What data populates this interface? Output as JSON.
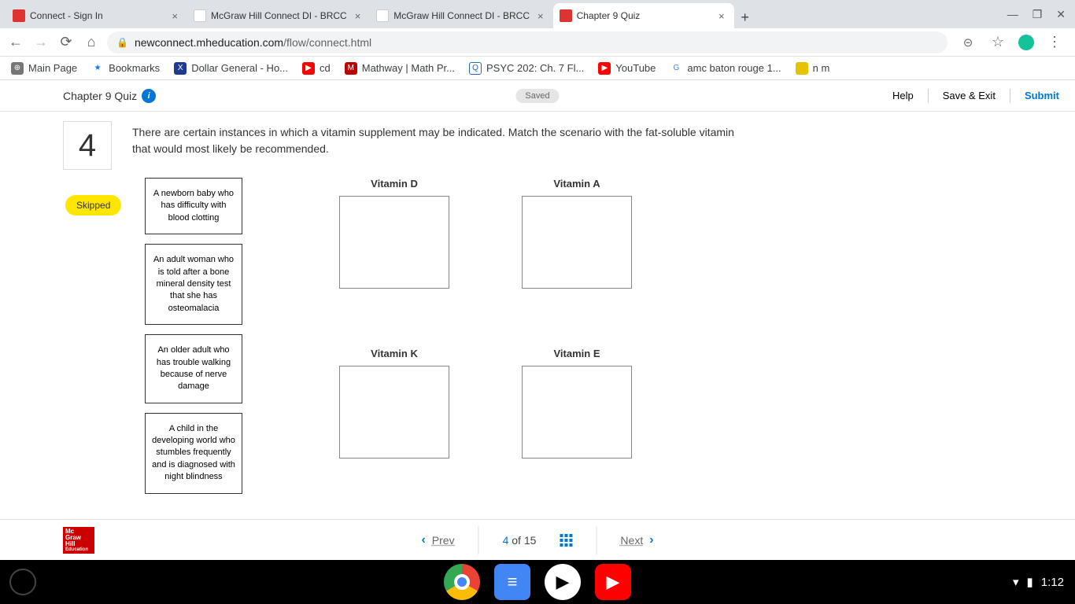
{
  "browser": {
    "tabs": [
      {
        "title": "Connect - Sign In"
      },
      {
        "title": "McGraw Hill Connect DI - BRCC"
      },
      {
        "title": "McGraw Hill Connect DI - BRCC"
      },
      {
        "title": "Chapter 9 Quiz"
      }
    ],
    "url_host": "newconnect.mheducation.com",
    "url_path": "/flow/connect.html"
  },
  "bookmarks": [
    {
      "label": "Main Page",
      "color": "#777"
    },
    {
      "label": "Bookmarks",
      "color": "#1a73e8"
    },
    {
      "label": "Dollar General - Ho...",
      "color": "#1f3a93"
    },
    {
      "label": "cd",
      "color": "#f00"
    },
    {
      "label": "Mathway | Math Pr...",
      "color": "#b00"
    },
    {
      "label": "PSYC 202: Ch. 7 Fl...",
      "color": "#2b6cb0"
    },
    {
      "label": "YouTube",
      "color": "#f00"
    },
    {
      "label": "amc baton rouge 1...",
      "color": "#4285f4"
    },
    {
      "label": "n m",
      "color": "#e6c200"
    }
  ],
  "app_header": {
    "title": "Chapter 9 Quiz",
    "saved": "Saved",
    "help": "Help",
    "save_exit": "Save & Exit",
    "submit": "Submit"
  },
  "question": {
    "number": "4",
    "text": "There are certain instances in which a vitamin supplement may be indicated. Match the scenario with the fat-soluble vitamin that would most likely be recommended.",
    "status": "Skipped"
  },
  "scenarios": [
    "A newborn baby who has difficulty with blood clotting",
    "An adult woman who is told after a bone mineral density test that she has osteomalacia",
    "An older adult who has trouble walking because of nerve damage",
    "A child in the developing world who stumbles frequently and is diagnosed with night blindness"
  ],
  "targets": [
    "Vitamin D",
    "Vitamin A",
    "Vitamin K",
    "Vitamin E"
  ],
  "footer": {
    "prev": "Prev",
    "next": "Next",
    "current": "4",
    "of": "of",
    "total": "15",
    "logo_lines": [
      "Mc",
      "Graw",
      "Hill",
      "Education"
    ]
  },
  "os": {
    "time": "1:12"
  }
}
